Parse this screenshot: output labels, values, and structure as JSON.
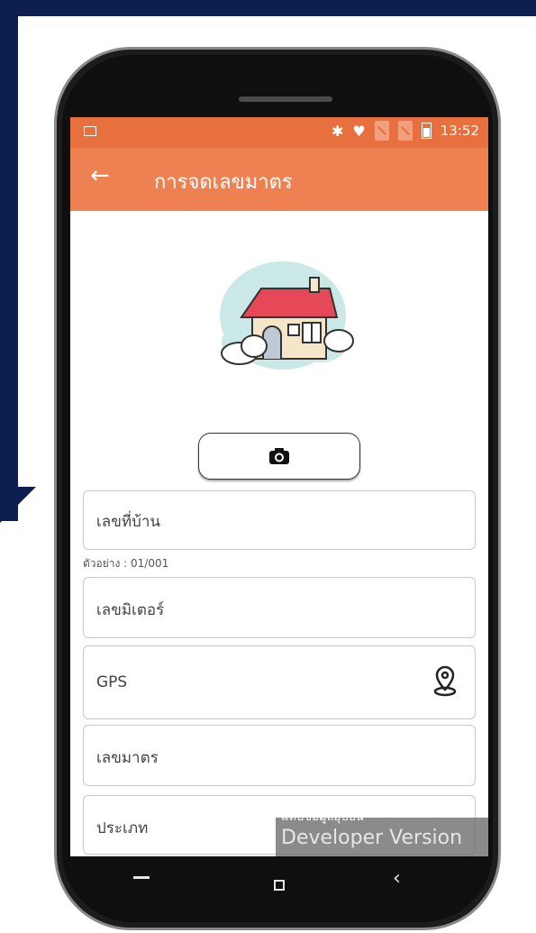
{
  "status_bar": {
    "time": "13:52",
    "icons": [
      "image-icon",
      "bluetooth-icon",
      "signal-icon",
      "no-sim-icon",
      "no-sim-icon",
      "battery-icon"
    ]
  },
  "app_bar": {
    "back_icon": "←",
    "title": "การจดเลขมาตร"
  },
  "camera_button": {
    "icon": "camera-icon"
  },
  "form": {
    "house_no": {
      "placeholder": "เลขที่บ้าน",
      "hint": "ตัวอย่าง : 01/001"
    },
    "meter_no": {
      "placeholder": "เลขมิเตอร์"
    },
    "gps": {
      "placeholder": "GPS",
      "icon": "location-pin-icon"
    },
    "meter_reading": {
      "placeholder": "เลขมาตร"
    },
    "type": {
      "placeholder": "ประเภท"
    }
  },
  "watermark": {
    "top": "แทบขอมูลอุปปน",
    "main": "Developer Version"
  },
  "nav": {
    "recent": "‹"
  },
  "colors": {
    "accent": "#ee8152",
    "status": "#e8703e",
    "background": "#0c1f4e"
  }
}
